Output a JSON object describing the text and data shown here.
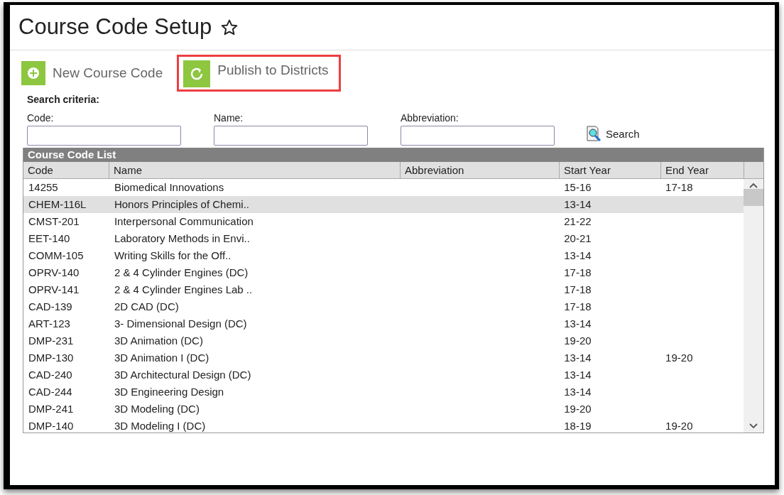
{
  "page": {
    "title": "Course Code Setup",
    "favorite": false
  },
  "actions": [
    {
      "label": "New Course Code",
      "kind": "add",
      "highlighted": false
    },
    {
      "label": "Publish to Districts",
      "kind": "refresh",
      "highlighted": true
    }
  ],
  "search": {
    "heading": "Search criteria:",
    "fields": [
      {
        "label": "Code:"
      },
      {
        "label": "Name:"
      },
      {
        "label": "Abbreviation:"
      }
    ],
    "button": "Search"
  },
  "table": {
    "title": "Course Code List",
    "columns": [
      "Code",
      "Name",
      "Abbreviation",
      "Start Year",
      "End Year"
    ],
    "rows": [
      {
        "cells": [
          "14255",
          "Biomedical Innovations",
          "",
          "15-16",
          "17-18"
        ],
        "selected": false
      },
      {
        "cells": [
          "CHEM-116L",
          "Honors Principles of Chemi..",
          "",
          "13-14",
          ""
        ],
        "selected": true
      },
      {
        "cells": [
          "CMST-201",
          "Interpersonal Communication",
          "",
          "21-22",
          ""
        ],
        "selected": false
      },
      {
        "cells": [
          "EET-140",
          "Laboratory Methods in Envi..",
          "",
          "20-21",
          ""
        ],
        "selected": false
      },
      {
        "cells": [
          "COMM-105",
          "Writing Skills for the Off..",
          "",
          "13-14",
          ""
        ],
        "selected": false
      },
      {
        "cells": [
          "OPRV-140",
          "2 & 4 Cylinder Engines (DC)",
          "",
          "17-18",
          ""
        ],
        "selected": false
      },
      {
        "cells": [
          "OPRV-141",
          "2 & 4 Cylinder Engines Lab ..",
          "",
          "17-18",
          ""
        ],
        "selected": false
      },
      {
        "cells": [
          "CAD-139",
          "2D CAD (DC)",
          "",
          "17-18",
          ""
        ],
        "selected": false
      },
      {
        "cells": [
          "ART-123",
          "3- Dimensional Design (DC)",
          "",
          "13-14",
          ""
        ],
        "selected": false
      },
      {
        "cells": [
          "DMP-231",
          "3D Animation (DC)",
          "",
          "19-20",
          ""
        ],
        "selected": false
      },
      {
        "cells": [
          "DMP-130",
          "3D Animation I (DC)",
          "",
          "13-14",
          "19-20"
        ],
        "selected": false
      },
      {
        "cells": [
          "CAD-240",
          "3D Architectural Design (DC)",
          "",
          "13-14",
          ""
        ],
        "selected": false
      },
      {
        "cells": [
          "CAD-244",
          "3D Engineering Design",
          "",
          "13-14",
          ""
        ],
        "selected": false
      },
      {
        "cells": [
          "DMP-241",
          "3D Modeling (DC)",
          "",
          "19-20",
          ""
        ],
        "selected": false
      },
      {
        "cells": [
          "DMP-140",
          "3D Modeling I (DC)",
          "",
          "18-19",
          "19-20"
        ],
        "selected": false
      }
    ]
  }
}
